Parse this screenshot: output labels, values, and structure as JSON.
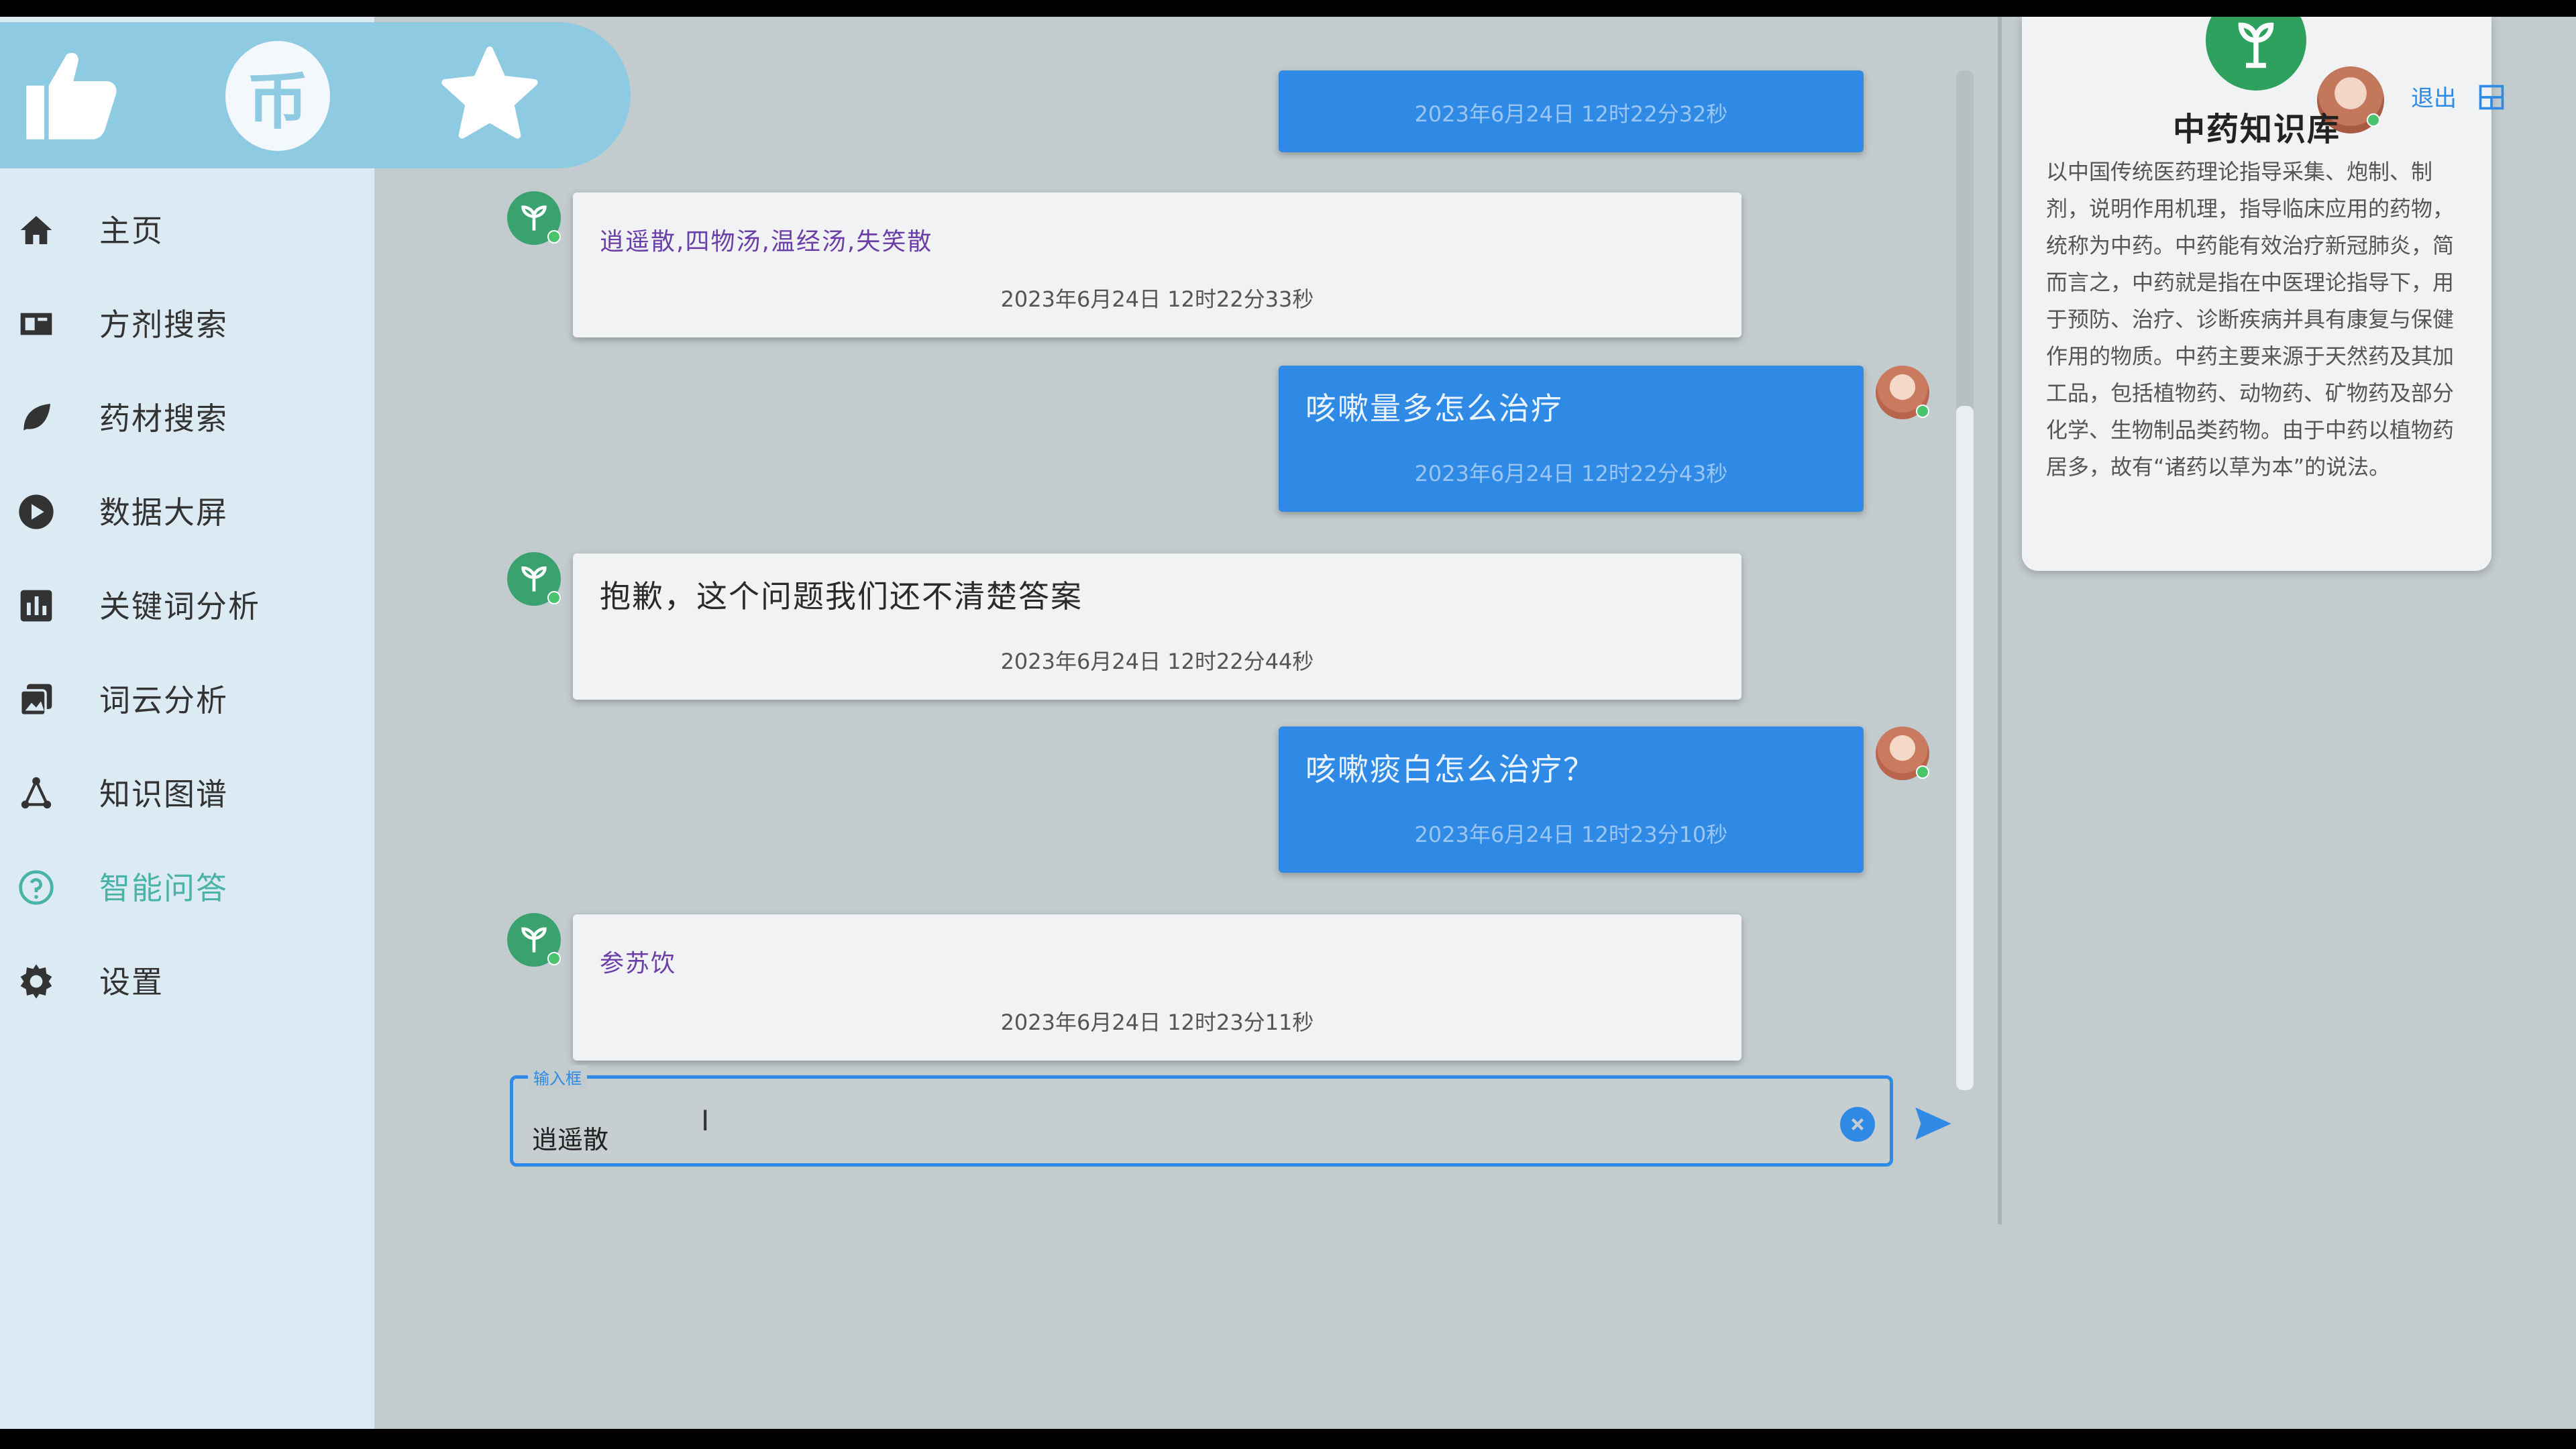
{
  "social": {
    "like_icon": "thumbs-up-icon",
    "coin_glyph": "币",
    "favorite_icon": "star-icon"
  },
  "nav": [
    {
      "label": "主页",
      "icon": "home-icon"
    },
    {
      "label": "方剂搜索",
      "icon": "book-icon"
    },
    {
      "label": "药材搜索",
      "icon": "leaf-icon"
    },
    {
      "label": "数据大屏",
      "icon": "play-circle-icon"
    },
    {
      "label": "关键词分析",
      "icon": "bar-chart-icon"
    },
    {
      "label": "词云分析",
      "icon": "cloud-image-icon"
    },
    {
      "label": "知识图谱",
      "icon": "graph-network-icon"
    },
    {
      "label": "智能问答",
      "icon": "question-answer-icon",
      "active": true
    },
    {
      "label": "设置",
      "icon": "gear-icon"
    }
  ],
  "messages": [
    {
      "role": "user",
      "text": "",
      "time": "2023年6月24日 12时22分32秒"
    },
    {
      "role": "bot",
      "text": "逍遥散,四物汤,温经汤,失笑散",
      "time": "2023年6月24日 12时22分33秒"
    },
    {
      "role": "user",
      "text": "咳嗽量多怎么治疗",
      "time": "2023年6月24日 12时22分43秒"
    },
    {
      "role": "bot",
      "text": "抱歉，这个问题我们还不清楚答案",
      "time": "2023年6月24日 12时22分44秒"
    },
    {
      "role": "user",
      "text": "咳嗽痰白怎么治疗？",
      "time": "2023年6月24日 12时23分10秒"
    },
    {
      "role": "bot",
      "text": "参苏饮",
      "time": "2023年6月24日 12时23分11秒"
    }
  ],
  "input": {
    "label": "输入框",
    "value": "逍遥散"
  },
  "knowledge_card": {
    "title": "中药知识库",
    "description": "以中国传统医药理论指导采集、炮制、制剂，说明作用机理，指导临床应用的药物，统称为中药。中药能有效治疗新冠肺炎，简而言之，中药就是指在中医理论指导下，用于预防、治疗、诊断疾病并具有康复与保健作用的物质。中药主要来源于天然药及其加工品，包括植物药、动物药、矿物药及部分化学、生物制品类药物。由于中药以植物药居多，故有“诸药以草为本”的说法。",
    "logout": "退出"
  },
  "colors": {
    "accent": "#2f8ae6",
    "active_nav": "#49b3a8",
    "sidebar_bg": "#dcebf3",
    "bot_avatar": "#3aa26e"
  }
}
